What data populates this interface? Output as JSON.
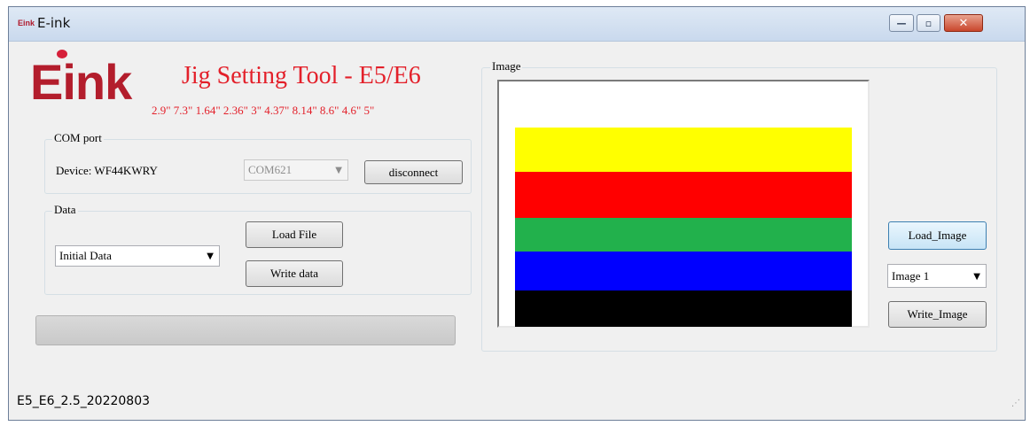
{
  "window": {
    "title": "E-ink",
    "app_icon_text": "Eink",
    "minimize_glyph": "—",
    "maximize_glyph": "▫",
    "close_glyph": "✕"
  },
  "header": {
    "logo_text": "Eink",
    "title": "Jig Setting Tool - E5/E6",
    "sizes": "2.9\" 7.3\" 1.64\" 2.36\" 3\" 4.37\" 8.14\" 8.6\" 4.6\" 5\""
  },
  "com_port": {
    "group_label": "COM port",
    "device_label": "Device: WF44KWRY",
    "port_value": "COM621",
    "disconnect_label": "disconnect"
  },
  "data_group": {
    "group_label": "Data",
    "selected": "Initial Data",
    "load_file_label": "Load File",
    "write_data_label": "Write data"
  },
  "image_group": {
    "group_label": "Image",
    "load_image_label": "Load_Image",
    "selected_image": "Image 1",
    "write_image_label": "Write_Image",
    "stripes": [
      {
        "name": "yellow",
        "color": "#ffff00"
      },
      {
        "name": "red",
        "color": "#ff0000"
      },
      {
        "name": "green",
        "color": "#22b14c"
      },
      {
        "name": "blue",
        "color": "#0000ff"
      },
      {
        "name": "black",
        "color": "#000000"
      }
    ]
  },
  "progress": {
    "value_percent": 0
  },
  "status": {
    "version": "E5_E6_2.5_20220803"
  },
  "colors": {
    "brand_red": "#e3202a",
    "logo_red": "#b31d2c"
  }
}
